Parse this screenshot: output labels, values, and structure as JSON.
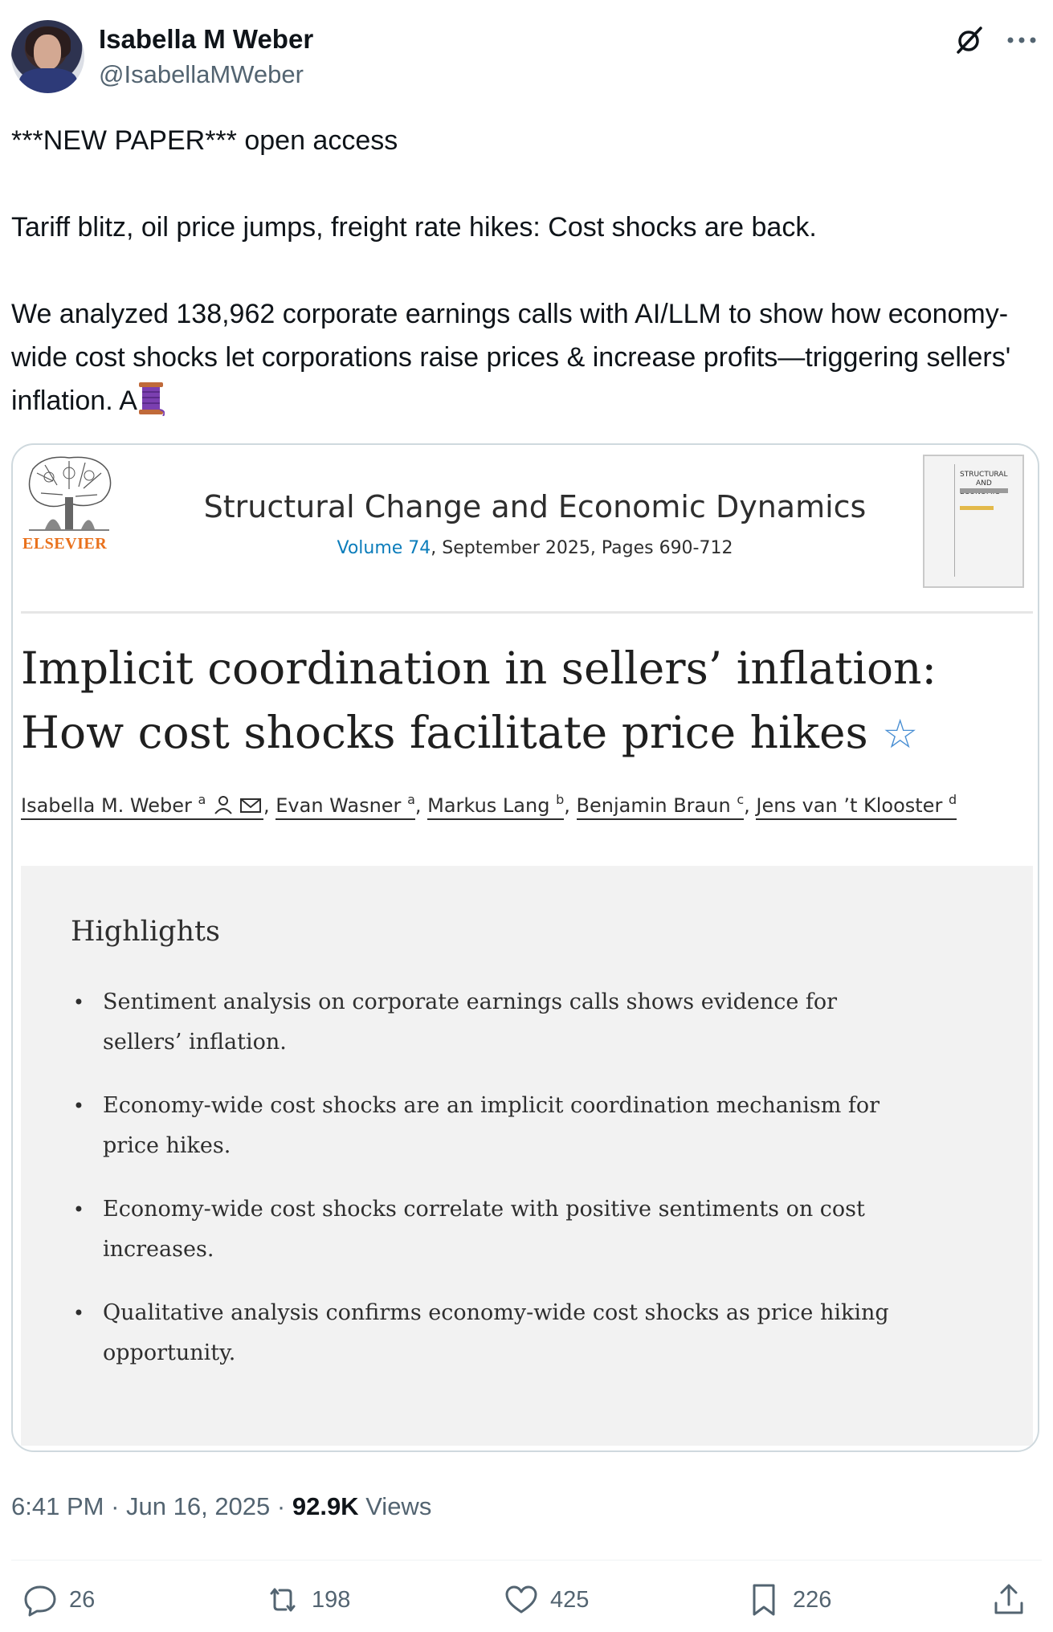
{
  "author": {
    "display_name": "Isabella M Weber",
    "handle": "@IsabellaMWeber",
    "avatar_icon": "profile-photo"
  },
  "header_icons": [
    "grok-icon",
    "more-icon"
  ],
  "tweet": {
    "line1": "***NEW PAPER*** open access",
    "line2": "Tariff blitz, oil price jumps, freight rate hikes: Cost shocks are back.",
    "line3": "We analyzed 138,962 corporate earnings calls with AI/LLM to show how economy-wide cost shocks let corporations raise prices & increase profits—triggering sellers' inflation. A",
    "thread_emoji": "spool-of-thread-icon"
  },
  "card": {
    "publisher": "ELSEVIER",
    "journal_title": "Structural Change and Economic Dynamics",
    "volume_link": "Volume 74",
    "volume_rest": ", September 2025, Pages 690-712",
    "cover_text": "STRUCTURAL\nAND\nECONOMIC",
    "paper_title_line1": "Implicit coordination in sellers’ inflation:",
    "paper_title_line2": "How cost shocks facilitate price hikes",
    "authors": [
      {
        "name": "Isabella M. Weber",
        "sup": "a"
      },
      {
        "name": "Evan Wasner",
        "sup": "a"
      },
      {
        "name": "Markus Lang",
        "sup": "b"
      },
      {
        "name": "Benjamin Braun",
        "sup": "c"
      },
      {
        "name": "Jens van ’t Klooster",
        "sup": "d"
      }
    ],
    "highlights_title": "Highlights",
    "highlights": [
      "Sentiment analysis on corporate earnings calls shows evidence for sellers’ inflation.",
      "Economy-wide cost shocks are an implicit coordination mechanism for price hikes.",
      "Economy-wide cost shocks correlate with positive sentiments on cost increases.",
      "Qualitative analysis confirms economy-wide cost shocks as price hiking opportunity."
    ],
    "bullet": "•"
  },
  "meta": {
    "time": "6:41 PM",
    "dot": " · ",
    "date": "Jun 16, 2025",
    "views_count": "92.9K",
    "views_label": " Views"
  },
  "actions": {
    "replies": "26",
    "reposts": "198",
    "likes": "425",
    "bookmarks": "226"
  },
  "colors": {
    "text": "#0f1419",
    "secondary": "#536471",
    "border": "#cfd9de",
    "link_blue": "#0c7dbb",
    "elsevier_orange": "#e9711c",
    "highlights_bg": "#f2f2f2"
  }
}
